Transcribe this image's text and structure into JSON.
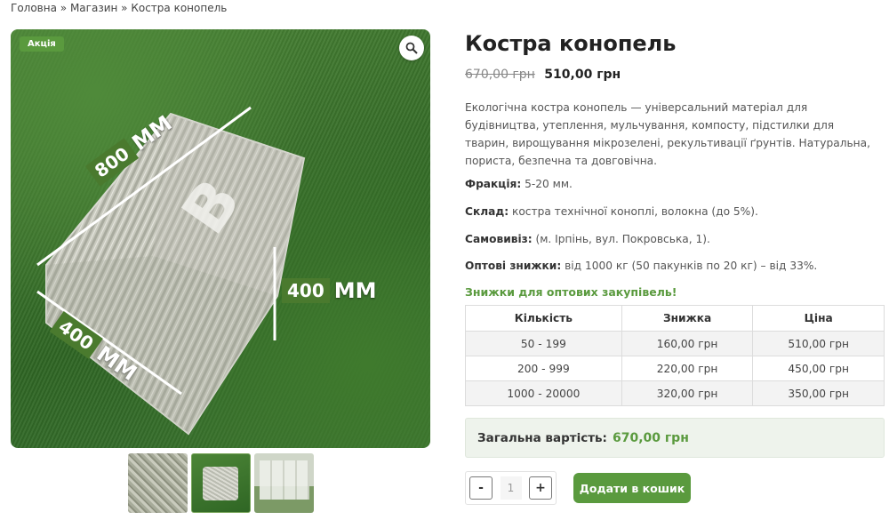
{
  "breadcrumb": {
    "home": "Головна",
    "sep1": "»",
    "shop": "Магазин",
    "sep2": "»",
    "current": "Костра конопель"
  },
  "gallery": {
    "sale_badge": "Акція",
    "dim_length_num": "800",
    "dim_length_unit": "ММ",
    "dim_height_num": "400",
    "dim_height_unit": "ММ",
    "dim_width_num": "400",
    "dim_width_unit": "ММ",
    "zoom_icon": "search-icon"
  },
  "product": {
    "title": "Костра конопель",
    "price_old": "670,00 грн",
    "price_new": "510,00 грн",
    "description": "Екологічна костра конопель — універсальний матеріал для будівництва, утеплення, мульчування, компосту, підстилки для тварин, вирощування мікрозелені, рекультивації ґрунтів. Натуральна, пориста, безпечна та довговічна.",
    "fraction_label": "Фракція:",
    "fraction_value": " 5-20 мм.",
    "composition_label": "Склад:",
    "composition_value": " костра технічної коноплі, волокна (до 5%).",
    "pickup_label": "Самовивіз:",
    "pickup_value": " (м. Ірпінь, вул. Покровська, 1).",
    "wholesale_label": "Оптові знижки:",
    "wholesale_value": "  від 1000 кг (50 пакунків по 20 кг) – від 33%.",
    "promo": "Знижки для оптових закупівель!"
  },
  "discount_table": {
    "headers": [
      "Кількість",
      "Знижка",
      "Ціна"
    ],
    "rows": [
      [
        "50 - 199",
        "160,00 грн",
        "510,00 грн"
      ],
      [
        "200 - 999",
        "220,00 грн",
        "450,00 грн"
      ],
      [
        "1000 - 20000",
        "320,00 грн",
        "350,00 грн"
      ]
    ]
  },
  "total": {
    "label": "Загальна вартість:",
    "value": "670,00 грн"
  },
  "cart": {
    "minus": "-",
    "quantity": "1",
    "plus": "+",
    "add_button": "Додати в кошик"
  },
  "colors": {
    "accent": "#5a9a3e",
    "grass": "#3a7230"
  }
}
